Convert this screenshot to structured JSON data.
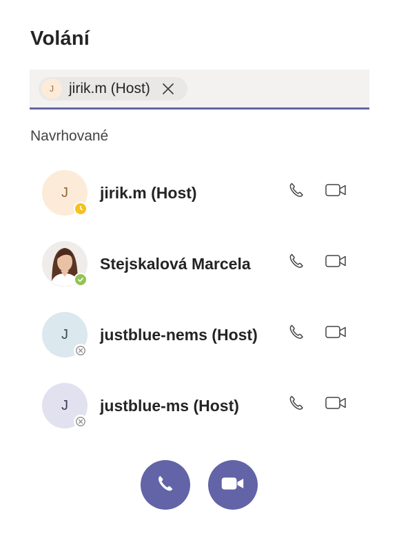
{
  "header": {
    "title": "Volání"
  },
  "recipient_field": {
    "chip": {
      "initial": "J",
      "label": "jirik.m (Host)"
    }
  },
  "suggested": {
    "label": "Navrhované",
    "contacts": [
      {
        "name": "jirik.m (Host)",
        "initial": "J",
        "avatar_bg": "#fcebd9",
        "avatar_fg": "#8f6736",
        "presence": "away",
        "presence_color": "#f8c11b"
      },
      {
        "name": "Stejskalová Marcela",
        "initial": "",
        "avatar_bg": "#7a5a4a",
        "avatar_fg": "#ffffff",
        "presence": "available",
        "presence_color": "#92c353"
      },
      {
        "name": "justblue-nems (Host)",
        "initial": "J",
        "avatar_bg": "#dbe8ee",
        "avatar_fg": "#3a4b54",
        "presence": "offline",
        "presence_color": "#ffffff"
      },
      {
        "name": "justblue-ms (Host)",
        "initial": "J",
        "avatar_bg": "#e2e1f0",
        "avatar_fg": "#3b3a56",
        "presence": "offline",
        "presence_color": "#ffffff"
      }
    ]
  },
  "actions": {
    "audio_call_icon": "phone-icon",
    "video_call_icon": "video-camera-icon"
  },
  "colors": {
    "accent": "#6264a7",
    "field_bg": "#f3f2f1",
    "text": "#242424"
  }
}
